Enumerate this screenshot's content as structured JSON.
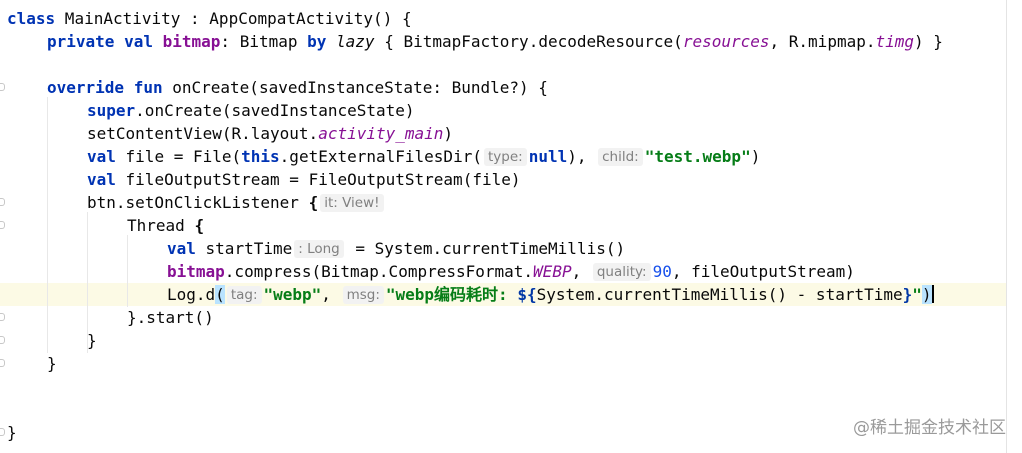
{
  "code": {
    "l1": {
      "class_kw": "class",
      "name": " MainActivity : AppCompatActivity() {"
    },
    "l2": {
      "private_kw": "private",
      "val_kw": "val",
      "field": "bitmap",
      "type": ": Bitmap ",
      "by_kw": "by",
      "lazy": "lazy",
      "body_open": " { BitmapFactory.decodeResource(",
      "resources": "resources",
      "mid": ", R.mipmap.",
      "timg": "timg",
      "close": ") }"
    },
    "l4": {
      "override_kw": "override",
      "fun_kw": "fun",
      "sig": " onCreate(savedInstanceState: Bundle?) {"
    },
    "l5": {
      "super_kw": "super",
      "rest": ".onCreate(savedInstanceState)"
    },
    "l6": {
      "pre": "setContentView(R.layout.",
      "res": "activity_main",
      "post": ")"
    },
    "l7": {
      "val_kw": "val",
      "pre": " file = File(",
      "this_kw": "this",
      "call": ".getExternalFilesDir(",
      "hint_type": "type:",
      "null_kw": "null",
      "comma": "), ",
      "hint_child": "child:",
      "filename": "\"test.webp\"",
      "close": ")"
    },
    "l8": {
      "val_kw": "val",
      "rest": " fileOutputStream = FileOutputStream(file)"
    },
    "l9": {
      "pre": "btn.setOnClickListener ",
      "brace": "{",
      "hint": "it: View!"
    },
    "l10": {
      "thread": "Thread ",
      "brace": "{"
    },
    "l11": {
      "val_kw": "val",
      "name": " startTime",
      "hint": ": Long",
      "rest": " = System.currentTimeMillis()"
    },
    "l12": {
      "field": "bitmap",
      "pre": ".compress(Bitmap.CompressFormat.",
      "format": "WEBP",
      "comma": ", ",
      "hint_quality": "quality:",
      "quality": "90",
      "post": ", fileOutputStream)"
    },
    "l13": {
      "pre": "Log.d",
      "open": "(",
      "hint_tag": "tag:",
      "tag": "\"webp\"",
      "comma": ", ",
      "hint_msg": "msg:",
      "msg_a": "\"webp编码耗时: ",
      "tmpl_open": "${",
      "tmpl_body": "System.currentTimeMillis() - startTime",
      "tmpl_close": "}",
      "msg_b": "\"",
      "close": ")"
    },
    "l14": "}.start()",
    "l15": "}",
    "l16": "}",
    "l19": "}"
  },
  "watermark": "@稀土掘金技术社区"
}
